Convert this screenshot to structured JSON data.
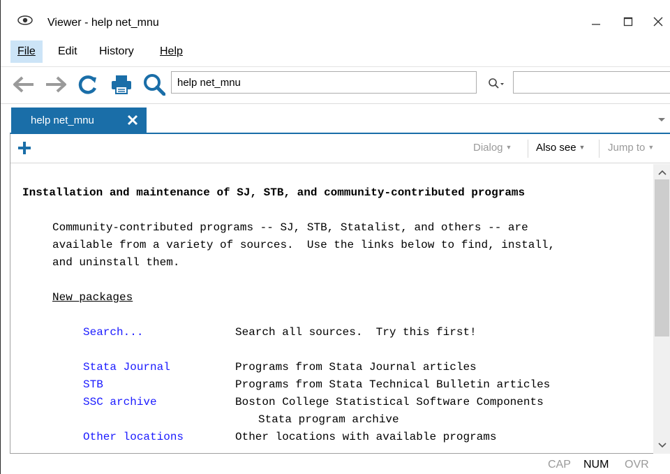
{
  "window": {
    "title": "Viewer - help net_mnu"
  },
  "menu": [
    {
      "label": "File"
    },
    {
      "label": "Edit"
    },
    {
      "label": "History"
    },
    {
      "label": "Help"
    }
  ],
  "toolbar": {
    "address_value": "help net_mnu",
    "find_value": ""
  },
  "tabs": [
    {
      "label": "help net_mnu"
    }
  ],
  "pane_toolbar": {
    "dialog_label": "Dialog",
    "also_see_label": "Also see",
    "jump_to_label": "Jump to"
  },
  "content": {
    "heading": "Installation and maintenance of SJ, STB, and community-contributed programs",
    "intro": [
      "Community-contributed programs -- SJ, STB, Statalist, and others -- are",
      "available from a variety of sources.  Use the links below to find, install,",
      "and uninstall them."
    ],
    "section_title": "New packages",
    "links": [
      {
        "label": "Search...",
        "desc": "Search all sources.  Try this first!",
        "desc2": ""
      },
      {
        "label": "Stata Journal",
        "desc": "Programs from Stata Journal articles",
        "desc2": ""
      },
      {
        "label": "STB",
        "desc": "Programs from Stata Technical Bulletin articles",
        "desc2": ""
      },
      {
        "label": "SSC archive",
        "desc": "Boston College Statistical Software Components",
        "desc2": "Stata program archive"
      },
      {
        "label": "Other locations",
        "desc": "Other locations with available programs",
        "desc2": ""
      }
    ]
  },
  "status": {
    "cap": "CAP",
    "num": "NUM",
    "ovr": "OVR"
  },
  "colors": {
    "tab_active": "#1a6ea8",
    "link": "#1a1aff",
    "toolbar_icon": "#1a6ea8",
    "menu_active": "#cce4f7"
  }
}
